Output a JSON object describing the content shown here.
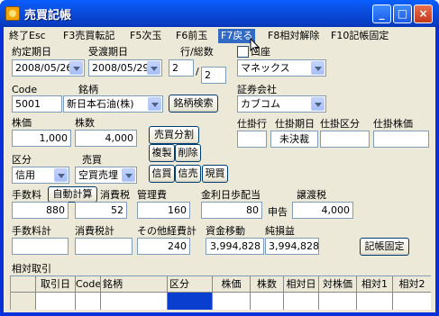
{
  "window": {
    "title": "売買記帳",
    "buttons": {
      "minimize": "_",
      "maximize": "□",
      "close": "×"
    }
  },
  "menu": [
    "終了Esc",
    "F3売買転記",
    "F5次玉",
    "F6前玉",
    "F7戻る",
    "F8相対解除",
    "F10記帳固定"
  ],
  "form": {
    "yakutei_label": "約定期日",
    "yakutei_value": "2008/05/26",
    "ukewatashi_label": "受渡期日",
    "ukewatashi_value": "2008/05/29",
    "gyo_label": "行/総数",
    "gyo_current": "2",
    "gyo_slash": "/",
    "gyo_total": "2",
    "koza_label": "口座",
    "koza_value": "マネックス",
    "code_label": "Code",
    "code_value": "5001",
    "meigara_label": "銘柄",
    "meigara_value": "新日本石油(株)",
    "search_button": "銘柄検索",
    "shoken_label": "証券会社",
    "shoken_value": "カブコム",
    "kabuka_label": "株価",
    "kabuka_value": "1,000",
    "kabusu_label": "株数",
    "kabusu_value": "4,000",
    "bunkatsu_button": "売買分割",
    "fukusei_button": "複製",
    "sakujo_button": "削除",
    "shikake_gyo_label": "仕掛行",
    "shikake_kijitsu_label": "仕掛期日",
    "shikake_kubun_label": "仕掛区分",
    "shikake_kabuka_label": "仕掛株価",
    "shikake_kijitsu_value": "未決裁",
    "kubun_label": "区分",
    "kubun_value": "信用",
    "baibai_label": "売買",
    "baibai_value": "空買売埋",
    "shinkai_button": "信買",
    "shinbai_button": "信売",
    "genkai_button": "現買",
    "tesuryo_label": "手数料",
    "tesuryo_value": "880",
    "jidou_button": "自動計算",
    "shohizei_label": "消費税",
    "shohizei_value": "52",
    "kanrihi_label": "管理費",
    "kanrihi_value": "160",
    "kinri_label": "金利日歩配当",
    "kinri_value": "80",
    "shinkoku_label": "申告",
    "joto_label": "譲渡税",
    "joto_value": "4,000",
    "tesuryokei_label": "手数料計",
    "shohizeikei_label": "消費税計",
    "sonota_label": "その他経費計",
    "sonota_value": "240",
    "shikin_label": "資金移動",
    "shikin_value": "3,994,828",
    "junson_label": "純損益",
    "junson_value": "3,994,828",
    "kichokotei_button": "記帳固定"
  },
  "grid": {
    "title": "相対取引",
    "columns": [
      "",
      "取引日",
      "Code",
      "銘柄",
      "区分",
      "株価",
      "株数",
      "相対日",
      "対株価",
      "相対1",
      "相対2"
    ]
  }
}
